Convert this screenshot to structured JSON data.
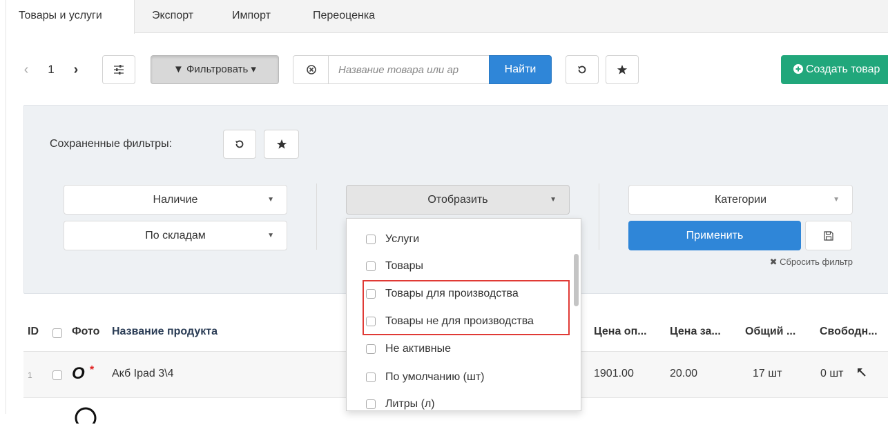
{
  "tabs": [
    {
      "label": "Товары и услуги",
      "active": true
    },
    {
      "label": "Экспорт"
    },
    {
      "label": "Импорт"
    },
    {
      "label": "Переоценка"
    }
  ],
  "toolbar": {
    "page_number": "1",
    "prev_glyph": "‹",
    "next_glyph": "›",
    "settings_icon": "sliders-icon",
    "filter_label": "▼ Фильтровать ▾",
    "clear_icon": "circle-x-icon",
    "search_placeholder": "Название товара или ар",
    "find_label": "Найти",
    "refresh_icon": "undo-icon",
    "favorite_icon": "star-icon",
    "create_label": "Создать товар"
  },
  "filters": {
    "saved_label": "Сохраненные фильтры:",
    "availability": "Наличие",
    "by_warehouse": "По складам",
    "display": "Отобразить",
    "categories": "Категории",
    "apply_label": "Применить",
    "reset_label": "Сбросить фильтр"
  },
  "display_options": [
    "Услуги",
    "Товары",
    "Товары для производства",
    "Товары не для производства",
    "Не активные",
    "По умолчанию (шт)",
    "Литры (л)"
  ],
  "table": {
    "columns": {
      "id": "ID",
      "photo": "Фото",
      "name": "Название продукта",
      "price_wholesale": "Цена оп...",
      "price_purchase": "Цена за...",
      "total": "Общий ...",
      "free": "Свободн..."
    },
    "rows": [
      {
        "id": "1",
        "name": "Акб Ipad 3\\4",
        "price_wholesale": "1901.00",
        "price_purchase": "20.00",
        "total": "17 шт",
        "free": "0 шт"
      }
    ]
  },
  "colors": {
    "primary": "#2f86d8",
    "success": "#21a77b",
    "highlight": "#e03a35",
    "panel": "#eef1f4"
  }
}
